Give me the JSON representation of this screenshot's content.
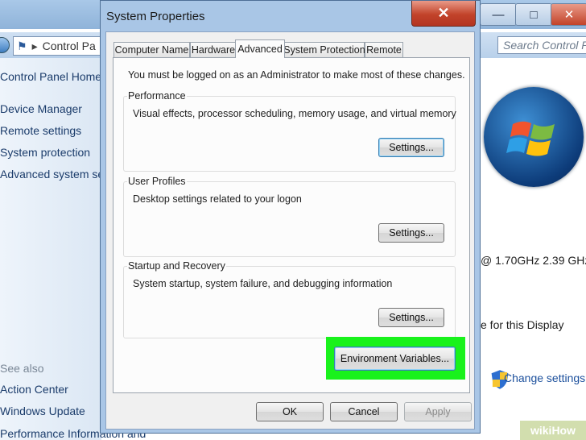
{
  "background_window": {
    "address": "Control Pa",
    "search_placeholder": "Search Control P",
    "sidebar": {
      "home": "Control Panel Home",
      "links": [
        "Device Manager",
        "Remote settings",
        "System protection",
        "Advanced system se"
      ],
      "see_also_heading": "See also",
      "see_also": [
        "Action Center",
        "Windows Update",
        "Performance Information and"
      ]
    },
    "processor_speed": "@ 1.70GHz   2.39 GHz",
    "display_text": "e for this Display",
    "change_settings": "Change settings",
    "watermark": "wikiHow",
    "controls": {
      "minimize": "—",
      "maximize": "□",
      "close": "✕"
    }
  },
  "dialog": {
    "title": "System Properties",
    "close_glyph": "✕",
    "tabs": [
      "Computer Name",
      "Hardware",
      "Advanced",
      "System Protection",
      "Remote"
    ],
    "active_tab": "Advanced",
    "notice": "You must be logged on as an Administrator to make most of these changes.",
    "groups": [
      {
        "title": "Performance",
        "description": "Visual effects, processor scheduling, memory usage, and virtual memory",
        "button": "Settings..."
      },
      {
        "title": "User Profiles",
        "description": "Desktop settings related to your logon",
        "button": "Settings..."
      },
      {
        "title": "Startup and Recovery",
        "description": "System startup, system failure, and debugging information",
        "button": "Settings..."
      }
    ],
    "env_button": "Environment Variables...",
    "ok": "OK",
    "cancel": "Cancel",
    "apply": "Apply",
    "highlight_color": "#19f21c"
  }
}
